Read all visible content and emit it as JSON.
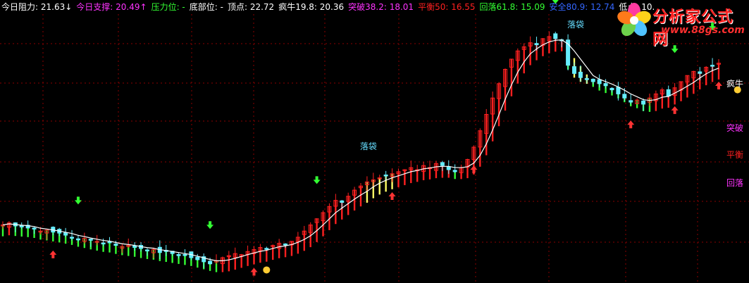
{
  "header": {
    "items": [
      {
        "text": "今日阻力: 21.63↓",
        "color": "#ffffff"
      },
      {
        "text": "今日支撑: 20.49↑",
        "color": "#ff33ff"
      },
      {
        "text": "压力位: -",
        "color": "#33ff33"
      },
      {
        "text": "底部位: -",
        "color": "#ffffff"
      },
      {
        "text": "顶点: 22.72",
        "color": "#ffffff"
      },
      {
        "text": "疯牛19.8: 20.36",
        "color": "#ffffff"
      },
      {
        "text": "突破38.2: 18.01",
        "color": "#ff33ff"
      },
      {
        "text": "平衡50: 16.55",
        "color": "#ff2020"
      },
      {
        "text": "回落61.8: 15.09",
        "color": "#33ff33"
      },
      {
        "text": "安全80.9: 12.74",
        "color": "#3366ff"
      },
      {
        "text": "低点: 10.",
        "color": "#ffffff"
      }
    ]
  },
  "logo": {
    "title": "分析家公式网",
    "url": "www.88gs.com"
  },
  "level_labels": {
    "crazy_bull": "疯牛",
    "breakout": "突破",
    "balance": "平衡",
    "pullback": "回落"
  },
  "annotations": {
    "fall": "落袋"
  },
  "colors": {
    "background": "#000000",
    "grid": "#8b0000",
    "up_fill": "#ff2020",
    "down_fill": "#66eeff",
    "white_line": "#ffffff",
    "band_red": "#ff2020",
    "band_green": "#33ff33",
    "band_yellow": "#ffff66",
    "buy_arrow": "#ff3333",
    "sell_arrow": "#33ff33"
  },
  "chart_data": {
    "type": "candlestick",
    "title": "",
    "ylim": [
      10.5,
      23.5
    ],
    "grid": true,
    "levels": [
      {
        "name": "疯牛",
        "value": 20.36
      },
      {
        "name": "突破",
        "value": 18.01
      },
      {
        "name": "平衡",
        "value": 16.55
      },
      {
        "name": "回落",
        "value": 15.09
      }
    ],
    "close_series": [
      13.2,
      13.3,
      13.15,
      13.1,
      13.05,
      13.0,
      12.9,
      12.95,
      12.85,
      12.8,
      12.7,
      12.6,
      12.5,
      12.55,
      12.45,
      12.4,
      12.3,
      12.35,
      12.2,
      12.15,
      12.2,
      12.1,
      12.05,
      11.95,
      12.0,
      11.85,
      11.9,
      11.8,
      11.7,
      11.75,
      11.6,
      11.5,
      11.4,
      11.3,
      11.45,
      11.6,
      11.7,
      11.8,
      11.75,
      11.9,
      12.0,
      12.1,
      12.05,
      12.2,
      12.3,
      12.25,
      12.4,
      12.6,
      12.9,
      13.2,
      13.5,
      13.8,
      14.1,
      14.4,
      14.3,
      14.6,
      14.9,
      15.1,
      15.3,
      15.4,
      15.5,
      15.6,
      15.7,
      15.8,
      15.9,
      16.0,
      15.9,
      16.1,
      16.0,
      16.2,
      16.1,
      15.9,
      15.8,
      16.0,
      16.4,
      17.0,
      17.8,
      18.6,
      19.4,
      20.1,
      20.8,
      21.3,
      21.7,
      21.9,
      22.1,
      22.0,
      22.3,
      22.4,
      22.3,
      22.2,
      21.0,
      20.6,
      20.4,
      20.3,
      20.2,
      20.1,
      20.0,
      19.8,
      19.6,
      19.4,
      19.2,
      19.3,
      19.1,
      19.4,
      19.6,
      19.8,
      19.5,
      19.9,
      20.2,
      20.5,
      20.7,
      20.6,
      20.9,
      21.0,
      21.1
    ],
    "buy_signals": [
      8,
      40,
      62,
      75,
      100,
      107,
      114,
      120,
      125,
      136
    ],
    "sell_signals": [
      12,
      33,
      50,
      88,
      107,
      113,
      118
    ]
  }
}
